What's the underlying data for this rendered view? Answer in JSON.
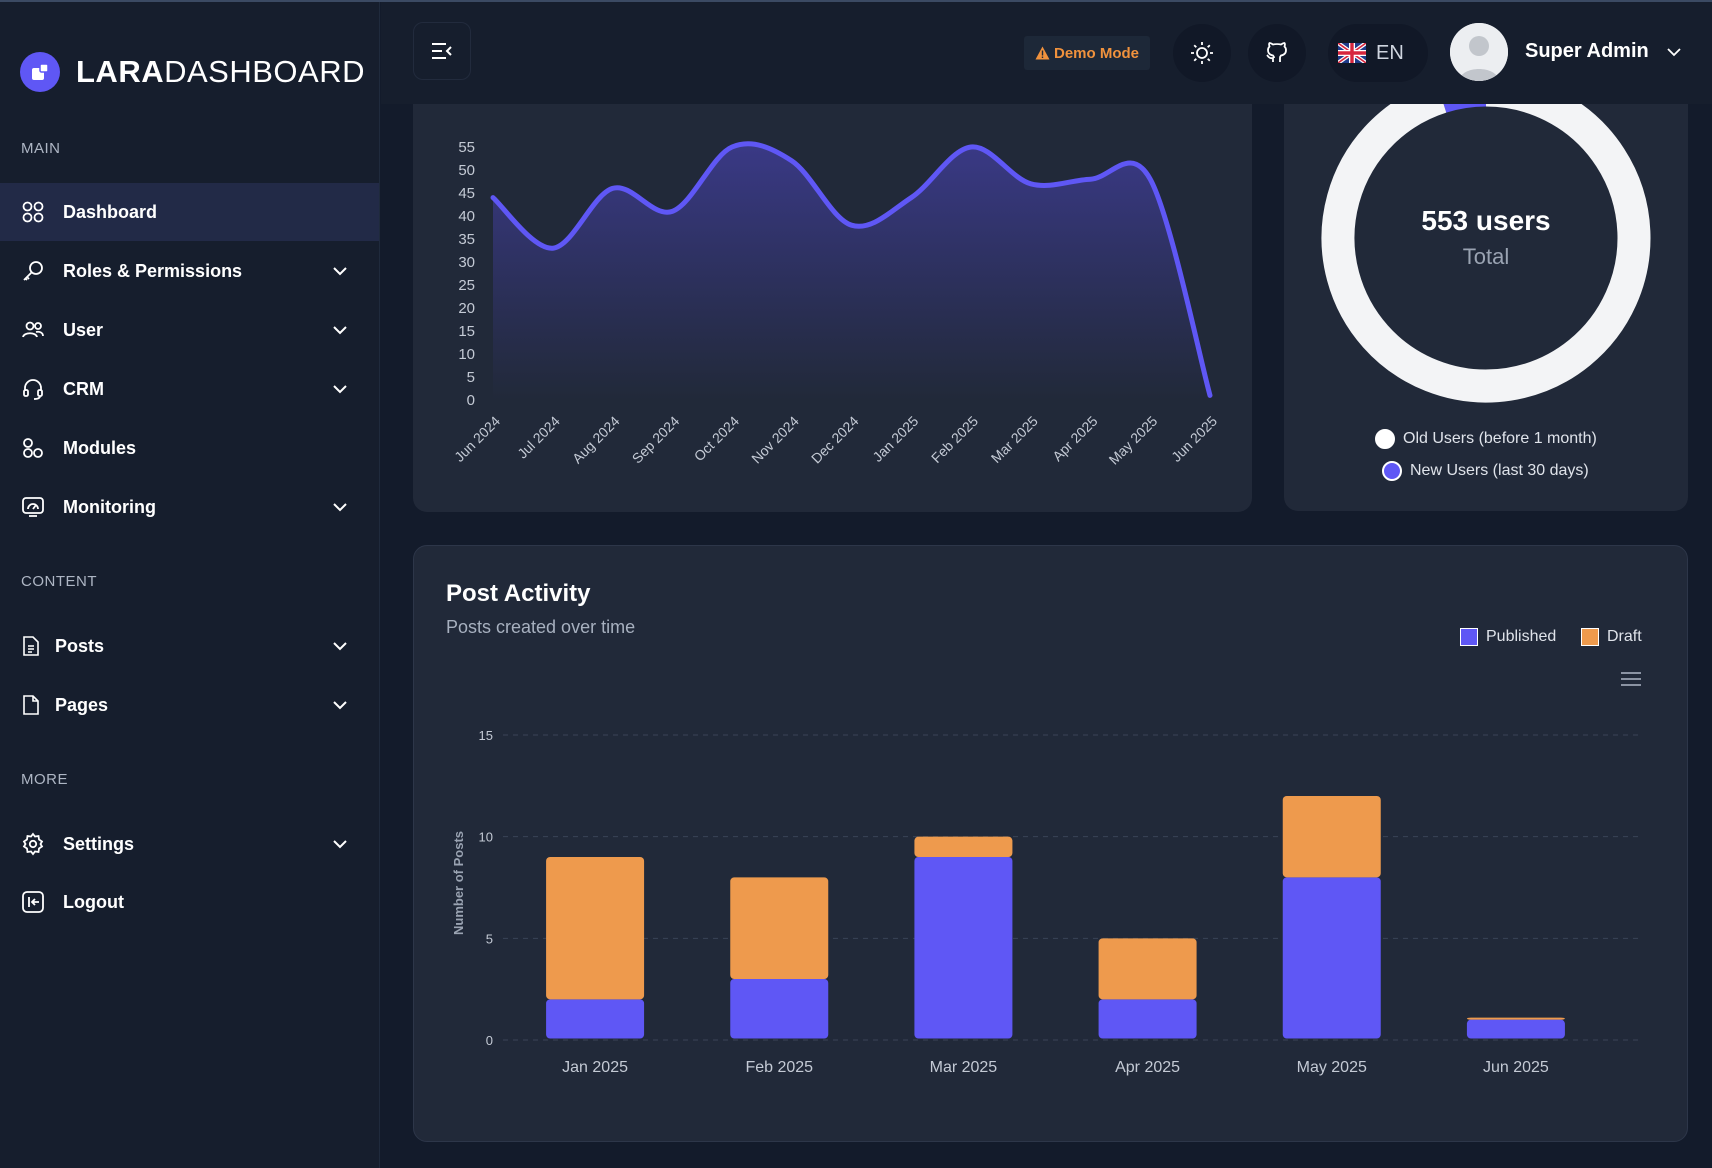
{
  "brand": {
    "bold": "LARA",
    "light": "DASHBOARD"
  },
  "sidebar": {
    "sections": [
      {
        "label": "MAIN"
      },
      {
        "label": "CONTENT"
      },
      {
        "label": "MORE"
      }
    ],
    "items": [
      {
        "label": "Dashboard",
        "icon": "grid-icon",
        "active": true
      },
      {
        "label": "Roles & Permissions",
        "icon": "key-icon"
      },
      {
        "label": "User",
        "icon": "users-icon"
      },
      {
        "label": "CRM",
        "icon": "headset-icon"
      },
      {
        "label": "Modules",
        "icon": "modules-icon"
      },
      {
        "label": "Monitoring",
        "icon": "monitor-icon"
      },
      {
        "label": "Posts",
        "icon": "document-icon"
      },
      {
        "label": "Pages",
        "icon": "page-icon"
      },
      {
        "label": "Settings",
        "icon": "gear-icon"
      },
      {
        "label": "Logout",
        "icon": "logout-icon"
      }
    ]
  },
  "header": {
    "demo_label": "Demo Mode",
    "language": "EN",
    "user_name": "Super Admin"
  },
  "donut": {
    "total_value": "553 users",
    "total_label": "Total",
    "legend": [
      {
        "label": "Old Users (before 1 month)",
        "color": "#f3f4f6"
      },
      {
        "label": "New Users (last 30 days)",
        "color": "#5f57f5"
      }
    ]
  },
  "post_activity": {
    "title": "Post Activity",
    "subtitle": "Posts created over time"
  },
  "colors": {
    "accent": "#5f57f5",
    "draft": "#ee9a4d",
    "card": "#212939",
    "sidebar": "#161e2d"
  },
  "chart_data": [
    {
      "type": "area",
      "title": "",
      "categories": [
        "Jun 2024",
        "Jul 2024",
        "Aug 2024",
        "Sep 2024",
        "Oct 2024",
        "Nov 2024",
        "Dec 2024",
        "Jan 2025",
        "Feb 2025",
        "Mar 2025",
        "Apr 2025",
        "May 2025",
        "Jun 2025"
      ],
      "series": [
        {
          "values": [
            44,
            33,
            46,
            41,
            55,
            52,
            38,
            44,
            55,
            47,
            48,
            48,
            1
          ]
        }
      ],
      "yticks": [
        0,
        5,
        10,
        15,
        20,
        25,
        30,
        35,
        40,
        45,
        50,
        55
      ],
      "ylim": [
        0,
        55
      ],
      "color": "#5f57f5"
    },
    {
      "type": "pie",
      "title": "",
      "categories": [
        "Old Users (before 1 month)",
        "New Users (last 30 days)"
      ],
      "values": [
        526,
        27
      ],
      "colors": [
        "#f3f4f6",
        "#5f57f5"
      ],
      "legend": "bottom"
    },
    {
      "type": "bar",
      "stacked": true,
      "title": "Post Activity",
      "subtitle": "Posts created over time",
      "ylabel": "Number of Posts",
      "categories": [
        "Jan 2025",
        "Feb 2025",
        "Mar 2025",
        "Apr 2025",
        "May 2025",
        "Jun 2025"
      ],
      "series": [
        {
          "name": "Published",
          "values": [
            2,
            3,
            9,
            2,
            8,
            1
          ],
          "color": "#5f57f5"
        },
        {
          "name": "Draft",
          "values": [
            7,
            5,
            1,
            3,
            4,
            0.1
          ],
          "color": "#ee9a4d"
        }
      ],
      "yticks": [
        0,
        5,
        10,
        15
      ],
      "ylim": [
        0,
        15
      ],
      "legend": "top-right",
      "grid": true
    }
  ]
}
